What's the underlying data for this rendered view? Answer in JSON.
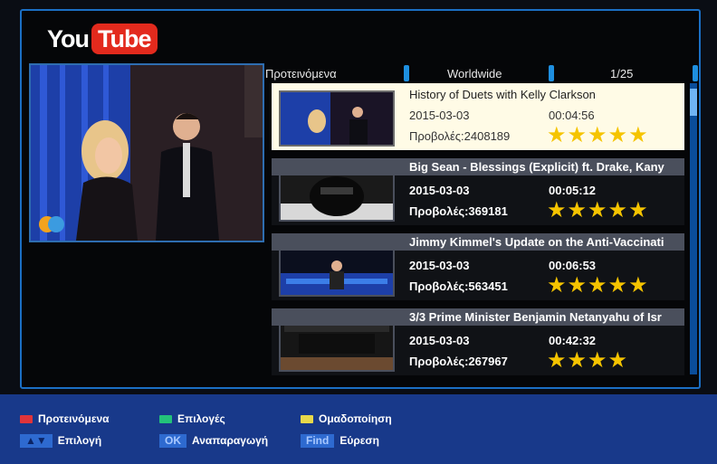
{
  "logo": {
    "you": "You",
    "tube": "Tube"
  },
  "header": {
    "category": "Προτεινόμενα",
    "region": "Worldwide",
    "page": "1/25"
  },
  "videos": [
    {
      "title": "History of Duets with Kelly Clarkson",
      "date": "2015-03-03",
      "duration": "00:04:56",
      "views": "Προβολές:2408189",
      "stars": "★★★★★",
      "rating": 5
    },
    {
      "title": "Big Sean - Blessings (Explicit) ft. Drake, Kany",
      "date": "2015-03-03",
      "duration": "00:05:12",
      "views": "Προβολές:369181",
      "stars": "★★★★★",
      "rating": 5
    },
    {
      "title": "Jimmy Kimmel's Update on the Anti-Vaccinati",
      "date": "2015-03-03",
      "duration": "00:06:53",
      "views": "Προβολές:563451",
      "stars": "★★★★★",
      "rating": 5
    },
    {
      "title": "3/3 Prime Minister Benjamin Netanyahu of Isr",
      "date": "2015-03-03",
      "duration": "00:42:32",
      "views": "Προβολές:267967",
      "stars": "★★★★",
      "rating": 4
    }
  ],
  "footer": {
    "red_label": "Προτεινόμενα",
    "green_label": "Επιλογές",
    "yellow_label": "Ομαδοποίηση",
    "nav_label": "Επιλογή",
    "ok_tag": "OK",
    "ok_label": "Αναπαραγωγή",
    "find_tag": "Find",
    "find_label": "Εύρεση"
  },
  "colors": {
    "accent": "#1b6fc4",
    "brand_red": "#e32a1d",
    "footer": "#18398a",
    "star": "#f5c400",
    "key_red": "#e0343a",
    "key_green": "#23c27a",
    "key_yellow": "#e8d94a"
  }
}
